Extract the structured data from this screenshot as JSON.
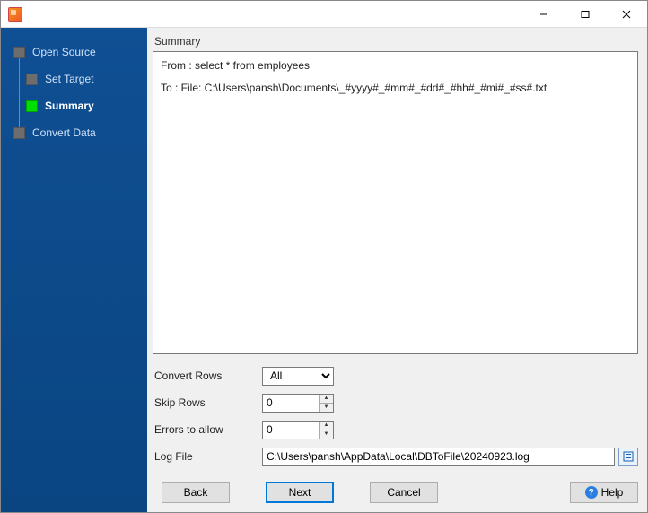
{
  "window": {
    "title": ""
  },
  "sidebar": {
    "steps": [
      {
        "label": "Open Source",
        "active": false,
        "sub": false
      },
      {
        "label": "Set Target",
        "active": false,
        "sub": true
      },
      {
        "label": "Summary",
        "active": true,
        "sub": true
      },
      {
        "label": "Convert Data",
        "active": false,
        "sub": false
      }
    ]
  },
  "main": {
    "panel_title": "Summary",
    "summary_lines": {
      "from": "From : select * from employees",
      "to": "To : File: C:\\Users\\pansh\\Documents\\_#yyyy#_#mm#_#dd#_#hh#_#mi#_#ss#.txt"
    },
    "form": {
      "convert_rows": {
        "label": "Convert Rows",
        "value": "All"
      },
      "skip_rows": {
        "label": "Skip Rows",
        "value": "0"
      },
      "errors_allow": {
        "label": "Errors to allow",
        "value": "0"
      },
      "log_file": {
        "label": "Log File",
        "value": "C:\\Users\\pansh\\AppData\\Local\\DBToFile\\20240923.log"
      }
    }
  },
  "buttons": {
    "back": "Back",
    "next": "Next",
    "cancel": "Cancel",
    "help": "Help"
  }
}
